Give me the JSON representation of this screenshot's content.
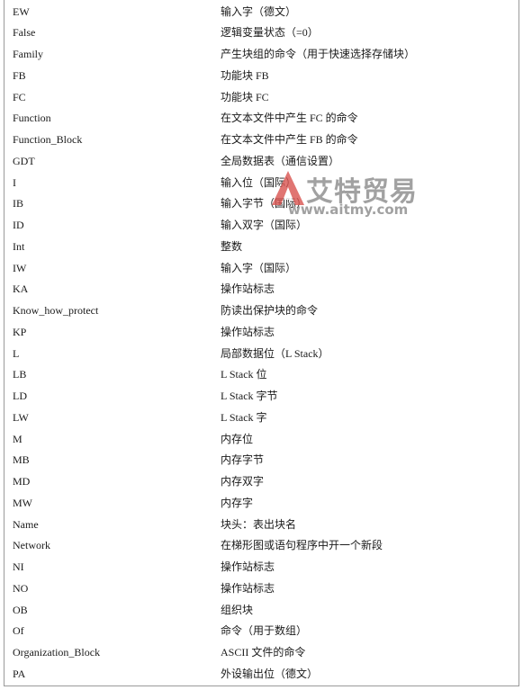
{
  "rows": [
    {
      "term": "EW",
      "desc": "输入字（德文）"
    },
    {
      "term": "False",
      "desc": "逻辑变量状态（=0）"
    },
    {
      "term": "Family",
      "desc": "产生块组的命令（用于快速选择存储块）"
    },
    {
      "term": "FB",
      "desc": "功能块 FB"
    },
    {
      "term": "FC",
      "desc": "功能块 FC"
    },
    {
      "term": "Function",
      "desc": "在文本文件中产生 FC 的命令"
    },
    {
      "term": "Function_Block",
      "desc": "在文本文件中产生 FB 的命令"
    },
    {
      "term": "GDT",
      "desc": "全局数据表（通信设置）"
    },
    {
      "term": "I",
      "desc": "输入位（国际）"
    },
    {
      "term": "IB",
      "desc": "输入字节（国际）"
    },
    {
      "term": "ID",
      "desc": "输入双字（国际）"
    },
    {
      "term": "Int",
      "desc": "整数"
    },
    {
      "term": "IW",
      "desc": "输入字（国际）"
    },
    {
      "term": "KA",
      "desc": "操作站标志"
    },
    {
      "term": "Know_how_protect",
      "desc": "防读出保护块的命令"
    },
    {
      "term": "KP",
      "desc": "操作站标志"
    },
    {
      "term": "L",
      "desc": "局部数据位（L Stack）"
    },
    {
      "term": "LB",
      "desc": "L Stack 位"
    },
    {
      "term": "LD",
      "desc": "L Stack 字节"
    },
    {
      "term": "LW",
      "desc": "L Stack 字"
    },
    {
      "term": "M",
      "desc": "内存位"
    },
    {
      "term": "MB",
      "desc": "内存字节"
    },
    {
      "term": "MD",
      "desc": "内存双字"
    },
    {
      "term": "MW",
      "desc": "内存字"
    },
    {
      "term": "Name",
      "desc": "块头：表出块名"
    },
    {
      "term": "Network",
      "desc": "在梯形图或语句程序中开一个新段"
    },
    {
      "term": "NI",
      "desc": "操作站标志"
    },
    {
      "term": "NO",
      "desc": "操作站标志"
    },
    {
      "term": "OB",
      "desc": "组织块"
    },
    {
      "term": "Of",
      "desc": "命令（用于数组）"
    },
    {
      "term": "Organization_Block",
      "desc": "ASCII 文件的命令"
    },
    {
      "term": "PA",
      "desc": "外设输出位（德文）"
    }
  ],
  "watermark": {
    "name": "艾特贸易",
    "url": "www.aitmy.com",
    "color": "#d9534f"
  }
}
